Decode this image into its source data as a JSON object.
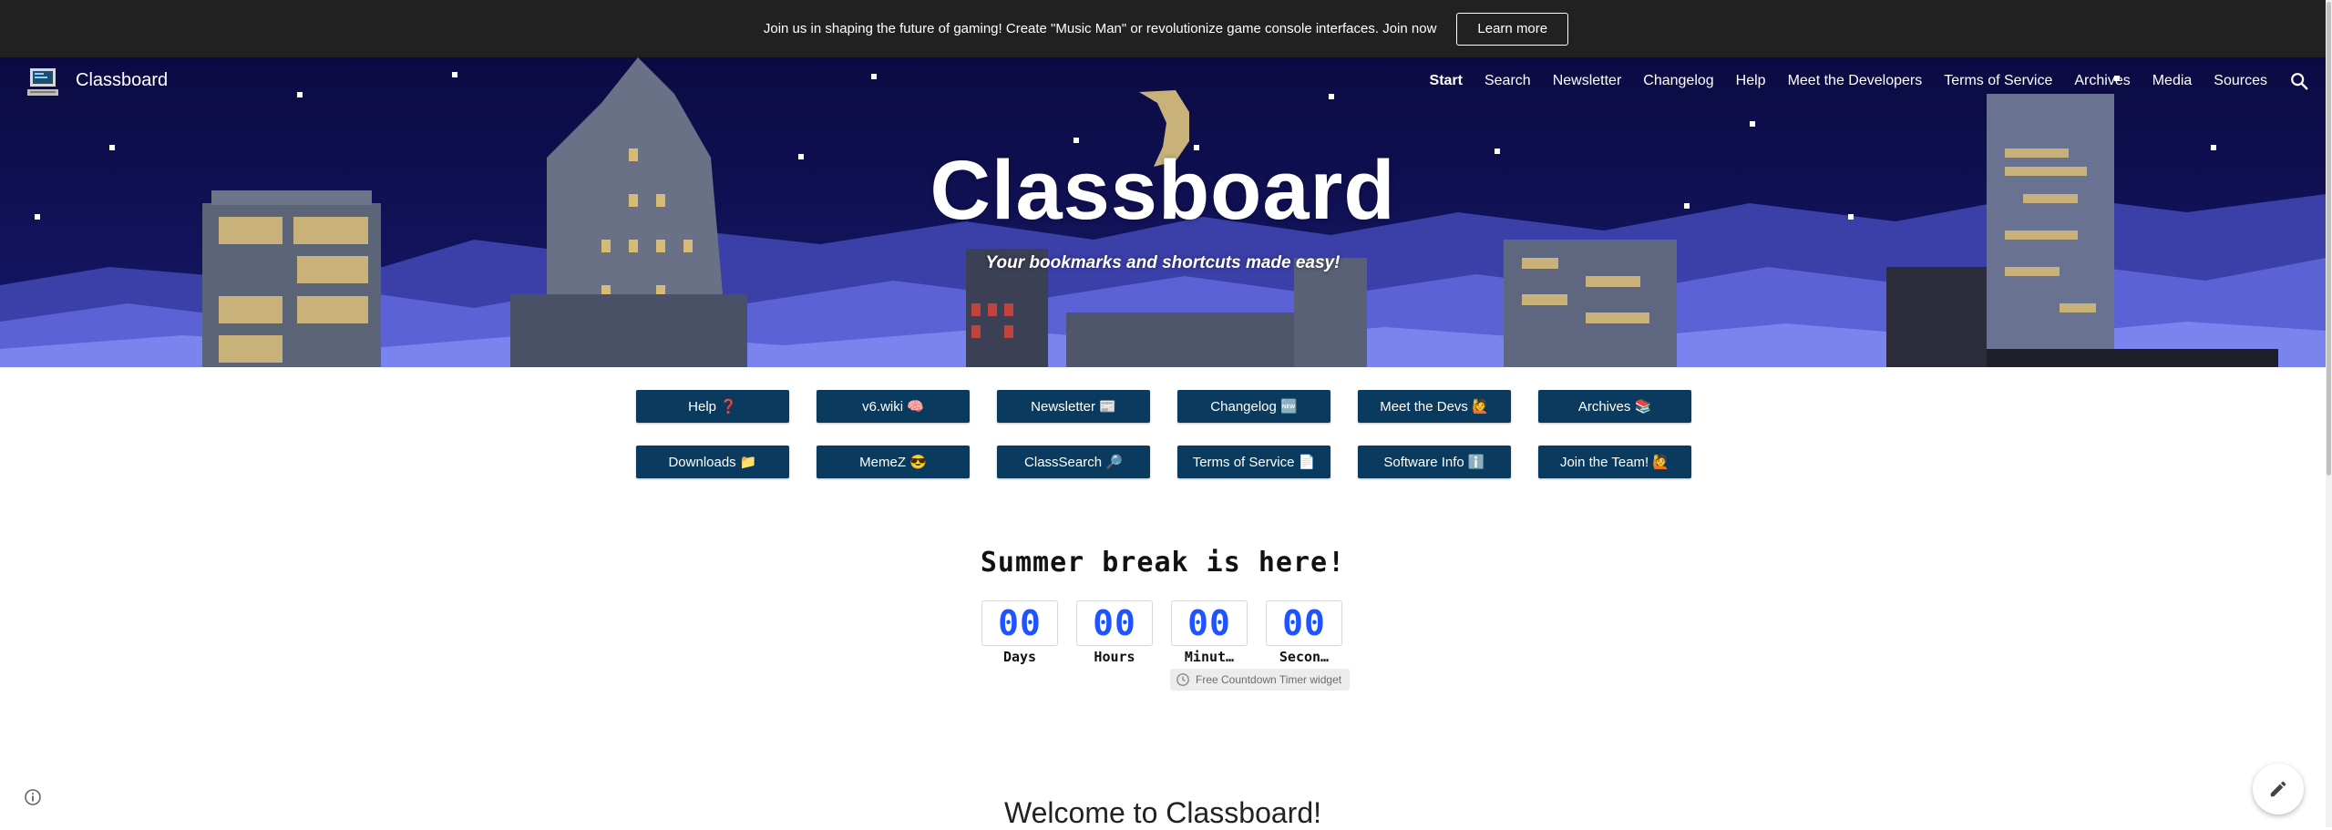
{
  "announcement": {
    "text": "Join us in shaping the future of gaming! Create \"Music Man\" or revolutionize game console interfaces. Join now",
    "button_label": "Learn more"
  },
  "header": {
    "site_name": "Classboard",
    "logo_icon": "retro-computer-icon",
    "nav": [
      {
        "label": "Start",
        "active": true
      },
      {
        "label": "Search"
      },
      {
        "label": "Newsletter"
      },
      {
        "label": "Changelog"
      },
      {
        "label": "Help"
      },
      {
        "label": "Meet the Developers"
      },
      {
        "label": "Terms of Service"
      },
      {
        "label": "Archives"
      },
      {
        "label": "Media"
      },
      {
        "label": "Sources"
      }
    ],
    "search_icon": "search-icon"
  },
  "hero": {
    "title": "Classboard",
    "subtitle": "Your bookmarks and shortcuts made easy!"
  },
  "quick_links": [
    {
      "label": "Help ❓"
    },
    {
      "label": "v6.wiki 🧠"
    },
    {
      "label": "Newsletter 📰"
    },
    {
      "label": "Changelog 🆕"
    },
    {
      "label": "Meet the Devs 🙋"
    },
    {
      "label": "Archives 📚"
    },
    {
      "label": "Downloads 📁"
    },
    {
      "label": "MemeZ 😎"
    },
    {
      "label": "ClassSearch 🔎"
    },
    {
      "label": "Terms of Service 📄"
    },
    {
      "label": "Software Info ℹ️"
    },
    {
      "label": "Join the Team! 🙋"
    }
  ],
  "countdown": {
    "title": "Summer break is here!",
    "units": [
      {
        "value": "00",
        "label": "Days"
      },
      {
        "value": "00",
        "label": "Hours"
      },
      {
        "value": "00",
        "label": "Minut…"
      },
      {
        "value": "00",
        "label": "Secon…"
      }
    ],
    "credit": "Free Countdown Timer widget"
  },
  "welcome": {
    "heading": "Welcome to Classboard!"
  },
  "colors": {
    "announcement_bg": "#212121",
    "sky": "#0c0b45",
    "button_bg": "#0a3b5e",
    "countdown_digits": "#1f53ff"
  }
}
